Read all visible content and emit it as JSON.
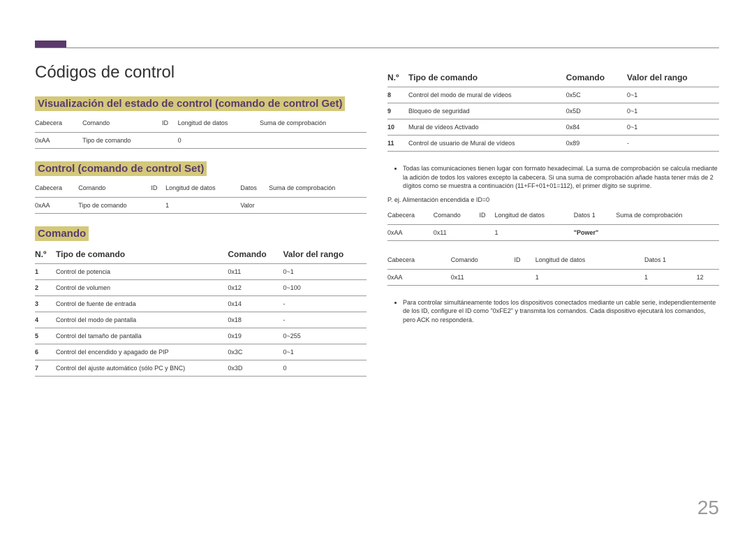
{
  "page_number": "25",
  "title": "Códigos de control",
  "section_get": {
    "heading": "Visualización del estado de control (comando de control Get)",
    "headers": [
      "Cabecera",
      "Comando",
      "ID",
      "Longitud de datos",
      "Suma de comprobación"
    ],
    "row": [
      "0xAA",
      "Tipo de comando",
      "",
      "0",
      ""
    ]
  },
  "section_set": {
    "heading": "Control (comando de control Set)",
    "headers": [
      "Cabecera",
      "Comando",
      "ID",
      "Longitud de datos",
      "Datos",
      "Suma de comprobación"
    ],
    "row": [
      "0xAA",
      "Tipo de comando",
      "",
      "1",
      "Valor",
      ""
    ]
  },
  "section_comando": {
    "heading": "Comando",
    "col_headers": {
      "nro": "N.º",
      "tipo": "Tipo de comando",
      "comando": "Comando",
      "rango": "Valor del rango"
    },
    "rows_left": [
      {
        "n": "1",
        "tipo": "Control de potencia",
        "cmd": "0x11",
        "rango": "0~1"
      },
      {
        "n": "2",
        "tipo": "Control de volumen",
        "cmd": "0x12",
        "rango": "0~100"
      },
      {
        "n": "3",
        "tipo": "Control de fuente de entrada",
        "cmd": "0x14",
        "rango": "-"
      },
      {
        "n": "4",
        "tipo": "Control del modo de pantalla",
        "cmd": "0x18",
        "rango": "-"
      },
      {
        "n": "5",
        "tipo": "Control del tamaño de pantalla",
        "cmd": "0x19",
        "rango": "0~255"
      },
      {
        "n": "6",
        "tipo": "Control del encendido y apagado de PIP",
        "cmd": "0x3C",
        "rango": "0~1"
      },
      {
        "n": "7",
        "tipo": "Control del ajuste automático (sólo PC y BNC)",
        "cmd": "0x3D",
        "rango": "0"
      }
    ],
    "rows_right": [
      {
        "n": "8",
        "tipo": "Control del modo de mural de vídeos",
        "cmd": "0x5C",
        "rango": "0~1"
      },
      {
        "n": "9",
        "tipo": "Bloqueo de seguridad",
        "cmd": "0x5D",
        "rango": "0~1"
      },
      {
        "n": "10",
        "tipo": "Mural de vídeos Activado",
        "cmd": "0x84",
        "rango": "0~1"
      },
      {
        "n": "11",
        "tipo": "Control de usuario de Mural de vídeos",
        "cmd": "0x89",
        "rango": "-"
      }
    ]
  },
  "bullet1": "Todas las comunicaciones tienen lugar con formato hexadecimal. La suma de comprobación se calcula mediante la adición de todos los valores excepto la cabecera. Si una suma de comprobación añade hasta tener más de 2 dígitos como se muestra a continuación (11+FF+01+01=112), el primer dígito se suprime.",
  "example_label": "P. ej. Alimentación encendida e ID=0",
  "example_table1": {
    "headers": [
      "Cabecera",
      "Comando",
      "ID",
      "Longitud de datos",
      "Datos 1",
      "Suma de comprobación"
    ],
    "row": [
      "0xAA",
      "0x11",
      "",
      "1",
      "\"Power\"",
      ""
    ]
  },
  "example_table2": {
    "headers": [
      "Cabecera",
      "Comando",
      "ID",
      "Longitud de datos",
      "Datos 1",
      ""
    ],
    "row": [
      "0xAA",
      "0x11",
      "",
      "1",
      "1",
      "12"
    ]
  },
  "bullet2": "Para controlar simultáneamente todos los dispositivos conectados mediante un cable serie, independientemente de los ID, configure el ID como \"0xFE2\" y transmita los comandos. Cada dispositivo ejecutará los comandos, pero ACK no responderá."
}
